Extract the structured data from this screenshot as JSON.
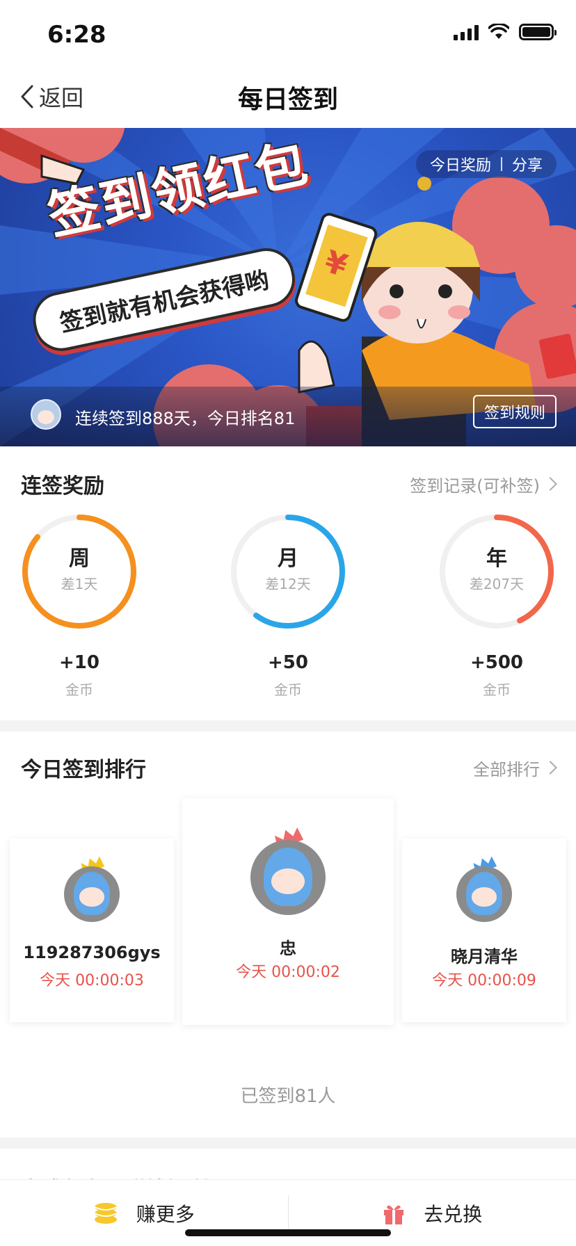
{
  "status_bar": {
    "time": "6:28"
  },
  "nav": {
    "back_label": "返回",
    "title": "每日签到"
  },
  "banner": {
    "top_links": [
      "今日奖励",
      "分享"
    ],
    "headline": "签到领红包",
    "subline": "签到就有机会获得哟",
    "status_text": "连续签到888天，今日排名81",
    "rules_button": "签到规则"
  },
  "streak": {
    "title": "连签奖励",
    "record_link": "签到记录(可补签)",
    "rings": [
      {
        "label": "周",
        "sub": "差1天",
        "progress": 0.86,
        "color": "#f5901f",
        "reward": "+10",
        "unit": "金币"
      },
      {
        "label": "月",
        "sub": "差12天",
        "progress": 0.6,
        "color": "#2aa6e8",
        "reward": "+50",
        "unit": "金币"
      },
      {
        "label": "年",
        "sub": "差207天",
        "progress": 0.43,
        "color": "#f2674a",
        "reward": "+500",
        "unit": "金币"
      }
    ]
  },
  "ranking": {
    "title": "今日签到排行",
    "all_link": "全部排行",
    "players": [
      {
        "name": "119287306gys",
        "time": "今天 00:00:03"
      },
      {
        "name": "忠",
        "time": "今天 00:00:02"
      },
      {
        "name": "晓月清华",
        "time": "今天 00:00:09"
      }
    ],
    "signed_count": "已签到81人"
  },
  "next_section_peek": "完成任务，赚钱福利",
  "tabbar": {
    "earn_label": "赚更多",
    "exchange_label": "去兑换"
  },
  "colors": {
    "accent_red": "#e5534b",
    "coin_yellow": "#f7c82a",
    "gift_red": "#ef6a6a"
  }
}
